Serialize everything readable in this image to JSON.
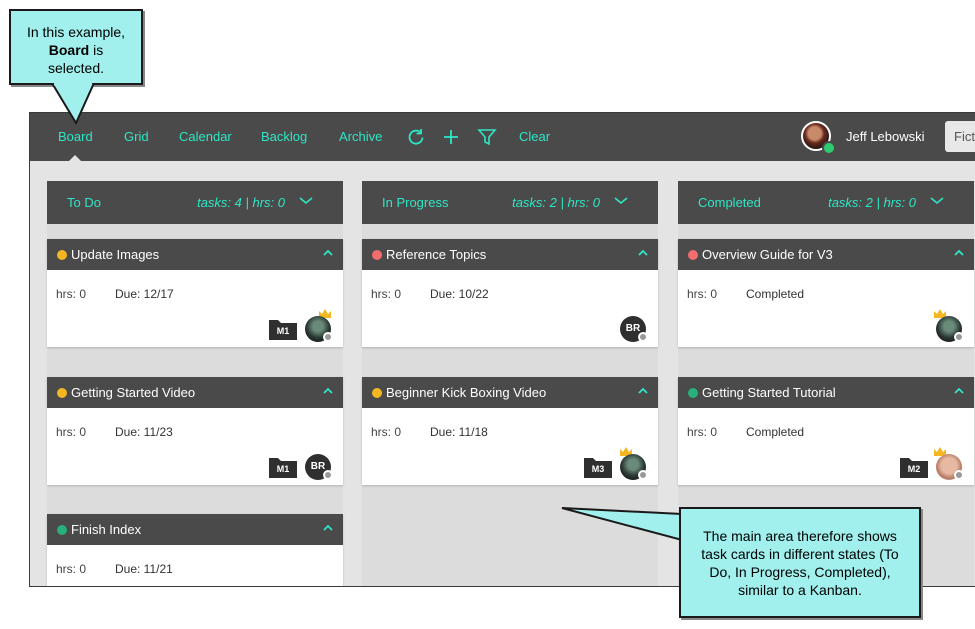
{
  "callout_top": {
    "line1": "In this example,",
    "bold": "Board",
    "after_bold": " is",
    "line3": "selected."
  },
  "callout_bottom": {
    "text": "The main area therefore shows task cards in different states (To Do, In Progress, Completed), similar to a Kanban."
  },
  "topbar": {
    "nav": [
      "Board",
      "Grid",
      "Calendar",
      "Backlog",
      "Archive"
    ],
    "selected": "Board",
    "icons": [
      "refresh-icon",
      "plus-icon",
      "filter-icon"
    ],
    "clear_label": "Clear",
    "user_name": "Jeff Lebowski",
    "search_value": "Ficti"
  },
  "colors": {
    "accent": "#2ee6c5",
    "bar": "#4a4a4a",
    "yellow": "#f5b623",
    "red": "#f26d6d",
    "green": "#27b07a"
  },
  "columns": [
    {
      "title": "To Do",
      "stats": "tasks: 4 | hrs: 0",
      "cards": [
        {
          "title": "Update Images",
          "status": "yellow",
          "hrs": "hrs: 0",
          "due": "Due: 12/17",
          "milestone": "M1",
          "avatar": "photo",
          "crown": true
        },
        {
          "title": "Getting Started Video",
          "status": "yellow",
          "hrs": "hrs: 0",
          "due": "Due: 11/23",
          "milestone": "M1",
          "avatar": "BR",
          "crown": false
        },
        {
          "title": "Finish Index",
          "status": "green",
          "hrs": "hrs: 0",
          "due": "Due: 11/21",
          "milestone": "",
          "avatar": "",
          "crown": false
        }
      ]
    },
    {
      "title": "In Progress",
      "stats": "tasks: 2 | hrs: 0",
      "cards": [
        {
          "title": "Reference Topics",
          "status": "red",
          "hrs": "hrs: 0",
          "due": "Due: 10/22",
          "milestone": "",
          "avatar": "BR",
          "crown": false
        },
        {
          "title": "Beginner Kick Boxing Video",
          "status": "yellow",
          "hrs": "hrs: 0",
          "due": "Due: 11/18",
          "milestone": "M3",
          "avatar": "photo",
          "crown": true
        }
      ]
    },
    {
      "title": "Completed",
      "stats": "tasks: 2 | hrs: 0",
      "cards": [
        {
          "title": "Overview Guide for V3",
          "status": "red",
          "hrs": "hrs: 0",
          "due": "Completed",
          "milestone": "",
          "avatar": "photo",
          "crown": true
        },
        {
          "title": "Getting Started Tutorial",
          "status": "green",
          "hrs": "hrs: 0",
          "due": "Completed",
          "milestone": "M2",
          "avatar": "face",
          "crown": true
        }
      ]
    }
  ]
}
